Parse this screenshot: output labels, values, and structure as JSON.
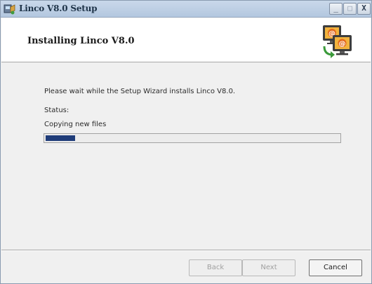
{
  "window": {
    "title": "Linco V8.0 Setup",
    "controls": {
      "minimize": "_",
      "maximize": "□",
      "close": "X"
    }
  },
  "header": {
    "title": "Installing Linco V8.0",
    "graphic_icon": "monitors-transfer-icon"
  },
  "main": {
    "message": "Please wait while the Setup Wizard installs Linco V8.0.",
    "status_label": "Status:",
    "status_value": "Copying new files",
    "progress": 0.1
  },
  "footer": {
    "back_label": "Back",
    "next_label": "Next",
    "cancel_label": "Cancel"
  },
  "colors": {
    "progress_fill": "#1f3c79",
    "titlebar": "#c9d8ea"
  }
}
